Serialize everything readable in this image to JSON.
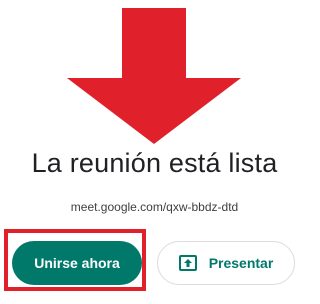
{
  "main": {
    "title": "La reunión está lista",
    "meeting_link": "meet.google.com/qxw-bbdz-dtd",
    "join_label": "Unirse ahora",
    "present_label": "Presentar"
  },
  "icons": {
    "arrow": "down-arrow-icon",
    "present": "present-screen-icon"
  },
  "colors": {
    "arrow": "#e0212b",
    "highlight": "#e0212b",
    "primary": "#00796b",
    "text": "#202124"
  }
}
